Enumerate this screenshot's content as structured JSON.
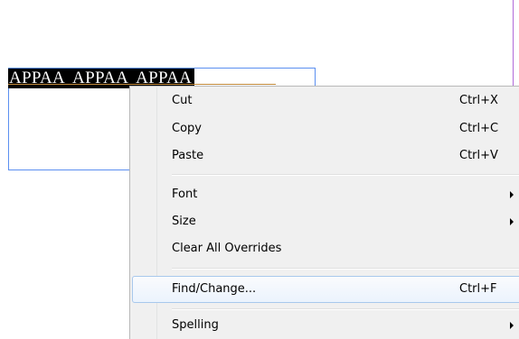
{
  "document": {
    "selected_text": "APPAA  APPAA  APPAA"
  },
  "context_menu": {
    "items": [
      {
        "label": "Cut",
        "shortcut": "Ctrl+X"
      },
      {
        "label": "Copy",
        "shortcut": "Ctrl+C"
      },
      {
        "label": "Paste",
        "shortcut": "Ctrl+V"
      },
      {
        "label": "Font",
        "submenu_icon": "chevron-right-icon"
      },
      {
        "label": "Size",
        "submenu_icon": "chevron-right-icon"
      },
      {
        "label": "Clear All Overrides"
      },
      {
        "label": "Find/Change...",
        "shortcut": "Ctrl+F",
        "highlighted": true
      },
      {
        "label": "Spelling",
        "submenu_icon": "chevron-right-icon"
      }
    ]
  },
  "colors": {
    "text_frame_border": "#5b8ff0",
    "selection_background": "#000000",
    "guide_line": "#b06ad9",
    "menu_background": "#f0f0f0",
    "menu_highlight_border": "#a8c8ec"
  }
}
